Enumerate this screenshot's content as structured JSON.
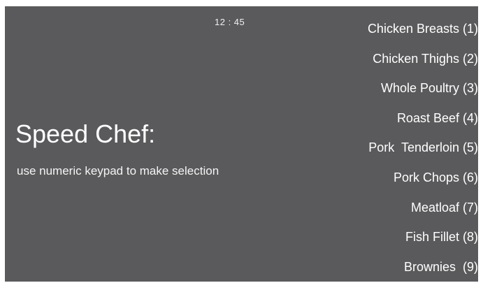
{
  "clock": "12 : 45",
  "title": "Speed Chef:",
  "subtitle": "use numeric keypad to make selection",
  "menu": [
    {
      "label": "Chicken Breasts (1)"
    },
    {
      "label": "Chicken Thighs (2)"
    },
    {
      "label": "Whole Poultry (3)"
    },
    {
      "label": "Roast Beef (4)"
    },
    {
      "label": "Pork  Tenderloin (5)"
    },
    {
      "label": "Pork Chops (6)"
    },
    {
      "label": "Meatloaf (7)"
    },
    {
      "label": "Fish Fillet (8)"
    },
    {
      "label": "Brownies  (9)"
    }
  ],
  "colors": {
    "background": "#5a5a5c",
    "text": "#ffffff"
  }
}
